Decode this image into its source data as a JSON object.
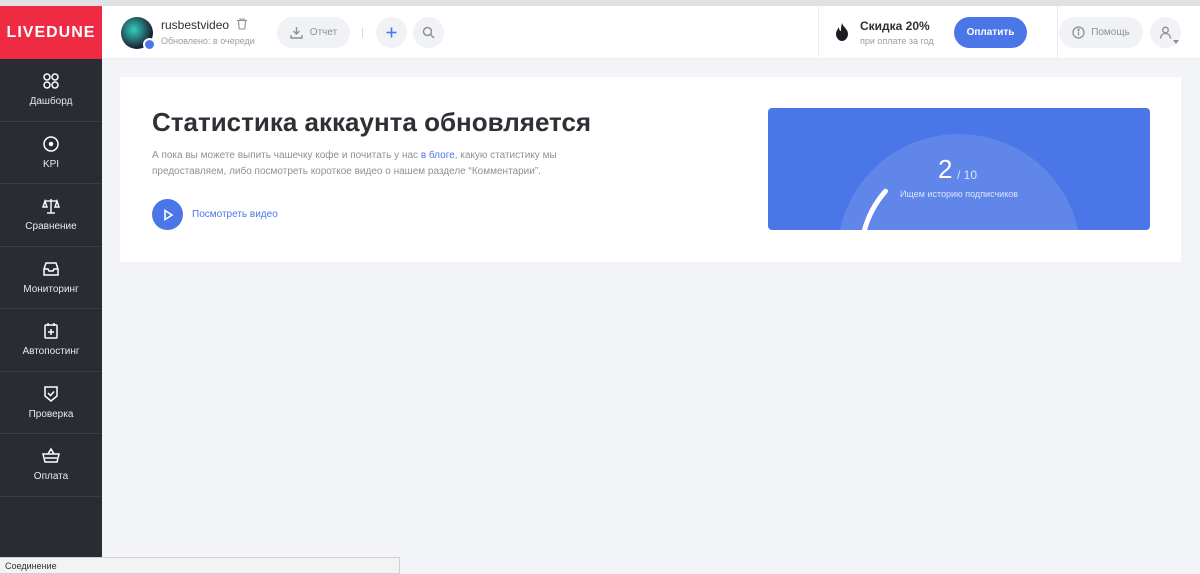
{
  "sidebar": {
    "logo": "LIVEDUNE",
    "items": [
      {
        "label": "Дашборд",
        "icon": "dashboard-icon"
      },
      {
        "label": "KPI",
        "icon": "target-icon"
      },
      {
        "label": "Сравнение",
        "icon": "scales-icon"
      },
      {
        "label": "Мониторинг",
        "icon": "inbox-icon"
      },
      {
        "label": "Автопостинг",
        "icon": "calendar-plus-icon"
      },
      {
        "label": "Проверка",
        "icon": "shield-check-icon"
      },
      {
        "label": "Оплата",
        "icon": "basket-icon"
      }
    ]
  },
  "topbar": {
    "account_name": "rusbestvideo",
    "updated_status": "Обновлено: в очереди",
    "report_label": "Отчет",
    "promo_title": "Скидка 20%",
    "promo_subtitle": "при оплате за год",
    "pay_label": "Оплатить",
    "help_label": "Помощь"
  },
  "card": {
    "title": "Статистика аккаунта обновляется",
    "desc_before": "А пока вы можете выпить чашечку кофе и почитать у нас ",
    "desc_link": "в блоге",
    "desc_after": ", какую статистику мы предоставляем, либо посмотреть короткое видео о нашем разделе “Комментарии”.",
    "video_label": "Посмотреть видео"
  },
  "progress": {
    "current": "2",
    "total": "/ 10",
    "label": "Ищем историю подписчиков",
    "fraction": 0.2
  },
  "statusbar": {
    "text": "Соединение"
  },
  "colors": {
    "brand_red": "#ef2b43",
    "accent_blue": "#4a76e8",
    "sidebar_dark": "#2a2c33"
  }
}
